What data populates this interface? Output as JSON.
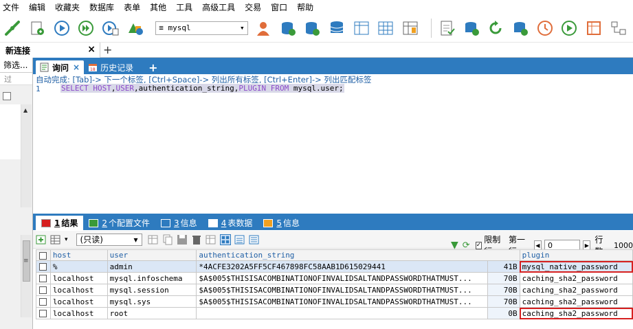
{
  "menu": [
    "文件",
    "编辑",
    "收藏夹",
    "数据库",
    "表单",
    "其他",
    "工具",
    "高级工具",
    "交易",
    "窗口",
    "帮助"
  ],
  "toolbar": {
    "db_select": "mysql"
  },
  "connection_tab": {
    "label": "新连接",
    "close": "×",
    "add": "+"
  },
  "left_panel": {
    "filter": "筛选...",
    "overflow": "过"
  },
  "query_tabs": [
    {
      "label": "询问",
      "close": "×"
    },
    {
      "label": "历史记录"
    }
  ],
  "query_tab_add": "+",
  "autocomplete_hint": "自动完成: [Tab]-> 下一个标签, [Ctrl+Space]-> 列出所有标签, [Ctrl+Enter]-> 列出匹配标签",
  "editor": {
    "line_number": "1",
    "sql_parts": [
      {
        "t": "SELECT",
        "kw": true
      },
      {
        "t": " ",
        "kw": false
      },
      {
        "t": "HOST",
        "kw": true
      },
      {
        "t": ",",
        "kw": false
      },
      {
        "t": "USER",
        "kw": true
      },
      {
        "t": ",authentication_string,",
        "kw": false
      },
      {
        "t": "PLUGIN",
        "kw": true
      },
      {
        "t": " ",
        "kw": false
      },
      {
        "t": "FROM",
        "kw": true
      },
      {
        "t": " mysql.user;",
        "kw": false
      }
    ]
  },
  "result_tabs": [
    {
      "num": "1",
      "label": "结果",
      "color": "#d62020"
    },
    {
      "num": "2",
      "label": "个配置文件",
      "color": "#3a9a3a"
    },
    {
      "num": "3",
      "label": "信息",
      "color": "#2e7bbf"
    },
    {
      "num": "4",
      "label": "表数据",
      "color": "#ffffff"
    },
    {
      "num": "5",
      "label": "信息",
      "color": "#f0a020"
    }
  ],
  "result_toolbar": {
    "readonly": "(只读)",
    "limit_label": "限制行",
    "first_row_label": "第一行:",
    "first_row_value": "0",
    "rows_label": "行数:",
    "rows_value": "1000"
  },
  "grid": {
    "columns": [
      "host",
      "user",
      "authentication_string",
      "plugin"
    ],
    "rows": [
      {
        "host": "%",
        "user": "admin",
        "auth": "*4ACFE3202A5FF5CF467898FC58AAB1D615029441",
        "size": "41B",
        "plugin": "mysql_native_password",
        "selected": true,
        "boxed": true
      },
      {
        "host": "localhost",
        "user": "mysql.infoschema",
        "auth": "$A$005$THISISACOMBINATIONOFINVALIDSALTANDPASSWORDTHATMUST...",
        "size": "70B",
        "plugin": "caching_sha2_password",
        "selected": false,
        "boxed": false
      },
      {
        "host": "localhost",
        "user": "mysql.session",
        "auth": "$A$005$THISISACOMBINATIONOFINVALIDSALTANDPASSWORDTHATMUST...",
        "size": "70B",
        "plugin": "caching_sha2_password",
        "selected": false,
        "boxed": false
      },
      {
        "host": "localhost",
        "user": "mysql.sys",
        "auth": "$A$005$THISISACOMBINATIONOFINVALIDSALTANDPASSWORDTHATMUST...",
        "size": "70B",
        "plugin": "caching_sha2_password",
        "selected": false,
        "boxed": false
      },
      {
        "host": "localhost",
        "user": "root",
        "auth": "",
        "size": "0B",
        "plugin": "caching_sha2_password",
        "selected": false,
        "boxed": true
      }
    ]
  },
  "colors": {
    "accent": "#2e7bbf",
    "highlight_box": "#d62020",
    "keyword": "#8b49c9"
  }
}
